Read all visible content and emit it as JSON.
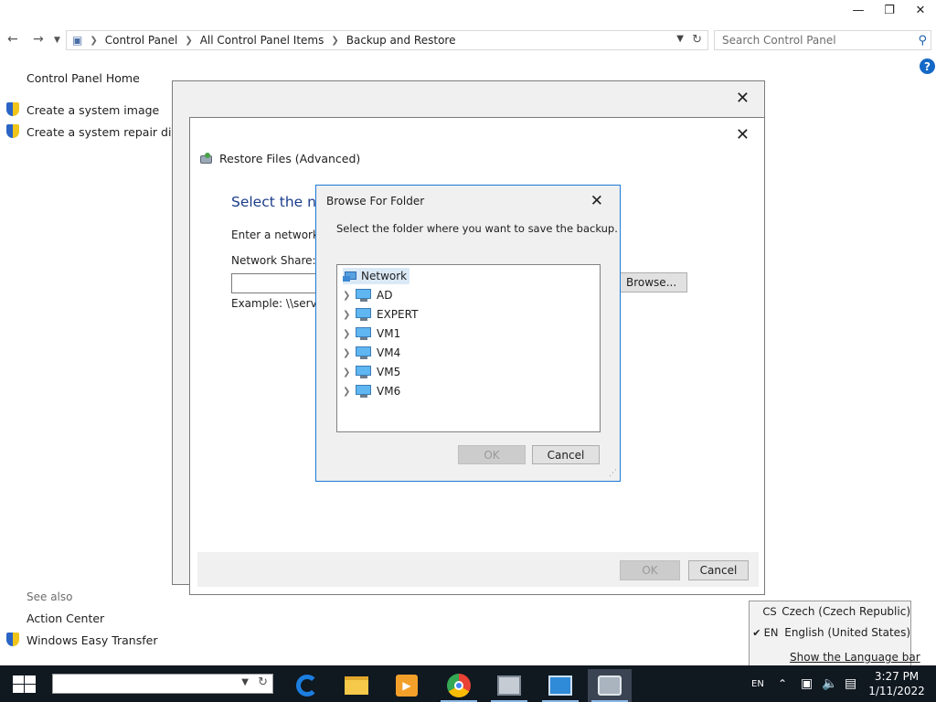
{
  "window": {
    "minimize_icon": "minimize-icon",
    "maximize_icon": "restore-icon",
    "close_icon": "close-icon"
  },
  "address_bar": {
    "crumbs": [
      "Control Panel",
      "All Control Panel Items",
      "Backup and Restore"
    ],
    "search_placeholder": "Search Control Panel"
  },
  "left_pane": {
    "home": "Control Panel Home",
    "links": [
      "Create a system image",
      "Create a system repair disc"
    ],
    "see_also_label": "See also",
    "see_also": [
      "Action Center",
      "Windows Easy Transfer"
    ]
  },
  "restore_dialog": {
    "title": "Restore Files (Advanced)",
    "heading": "Select the net",
    "enter_text": "Enter a network fo",
    "network_share_label": "Network Share:",
    "network_share_value": "",
    "example": "Example: \\\\server\\",
    "browse_label": "Browse...",
    "ok_label": "OK",
    "cancel_label": "Cancel"
  },
  "browse_dialog": {
    "title": "Browse For Folder",
    "instruction": "Select the folder where you want to save the backup.",
    "root": "Network",
    "items": [
      "AD",
      "EXPERT",
      "VM1",
      "VM4",
      "VM5",
      "VM6"
    ],
    "ok_label": "OK",
    "cancel_label": "Cancel"
  },
  "language_popup": {
    "languages": [
      {
        "code": "CS",
        "name": "Czech (Czech Republic)",
        "checked": false
      },
      {
        "code": "EN",
        "name": "English (United States)",
        "checked": true
      }
    ],
    "show_bar": "Show the Language bar"
  },
  "taskbar": {
    "tray_lang": "EN",
    "time": "3:27 PM",
    "date": "1/11/2022"
  },
  "colors": {
    "accent": "#1e7ad6",
    "heading": "#1a3c8a",
    "taskbar": "#101820"
  }
}
